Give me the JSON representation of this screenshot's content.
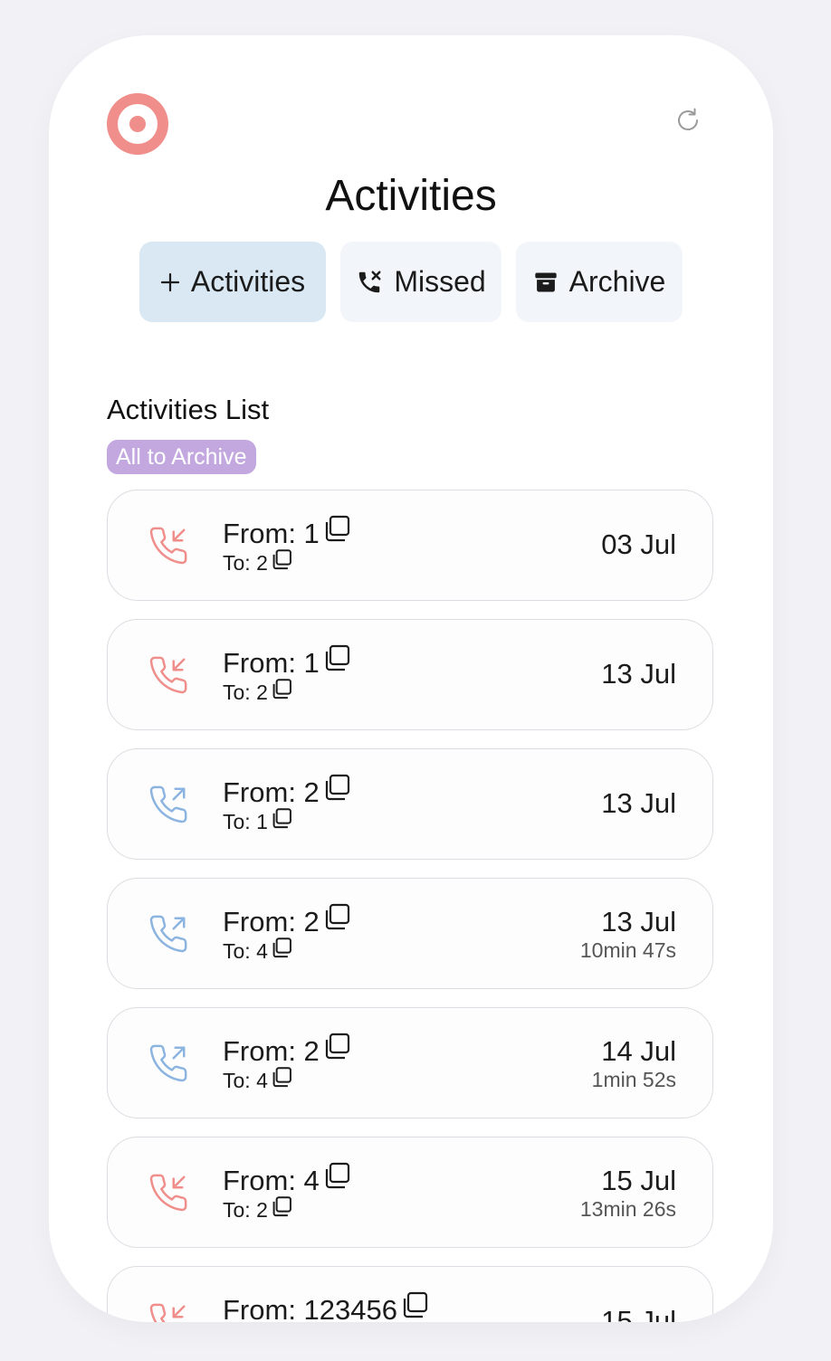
{
  "header": {
    "title": "Activities",
    "logo_color": "#ef8e8a",
    "refresh_icon": "refresh-icon"
  },
  "tabs": [
    {
      "label": "Activities",
      "icon": "plus-icon",
      "active": true
    },
    {
      "label": "Missed",
      "icon": "missed-call-icon",
      "active": false
    },
    {
      "label": "Archive",
      "icon": "archive-box-icon",
      "active": false
    }
  ],
  "list": {
    "title": "Activities List",
    "archive_all_label": "All to Archive",
    "items": [
      {
        "direction": "incoming",
        "from": "From: 1",
        "to": "To: 2",
        "date": "03 Jul",
        "duration": ""
      },
      {
        "direction": "incoming",
        "from": "From: 1",
        "to": "To: 2",
        "date": "13 Jul",
        "duration": ""
      },
      {
        "direction": "outgoing",
        "from": "From: 2",
        "to": "To: 1",
        "date": "13 Jul",
        "duration": ""
      },
      {
        "direction": "outgoing",
        "from": "From: 2",
        "to": "To: 4",
        "date": "13 Jul",
        "duration": "10min 47s"
      },
      {
        "direction": "outgoing",
        "from": "From: 2",
        "to": "To: 4",
        "date": "14 Jul",
        "duration": "1min 52s"
      },
      {
        "direction": "incoming",
        "from": "From: 4",
        "to": "To: 2",
        "date": "15 Jul",
        "duration": "13min 26s"
      },
      {
        "direction": "incoming",
        "from": "From: 123456",
        "to": "",
        "date": "15 Jul",
        "duration": ""
      }
    ]
  },
  "colors": {
    "incoming": "#ef8e8a",
    "outgoing": "#8cb4e0",
    "active_tab": "#d9e8f2",
    "archive_badge": "#c3a8e0"
  }
}
